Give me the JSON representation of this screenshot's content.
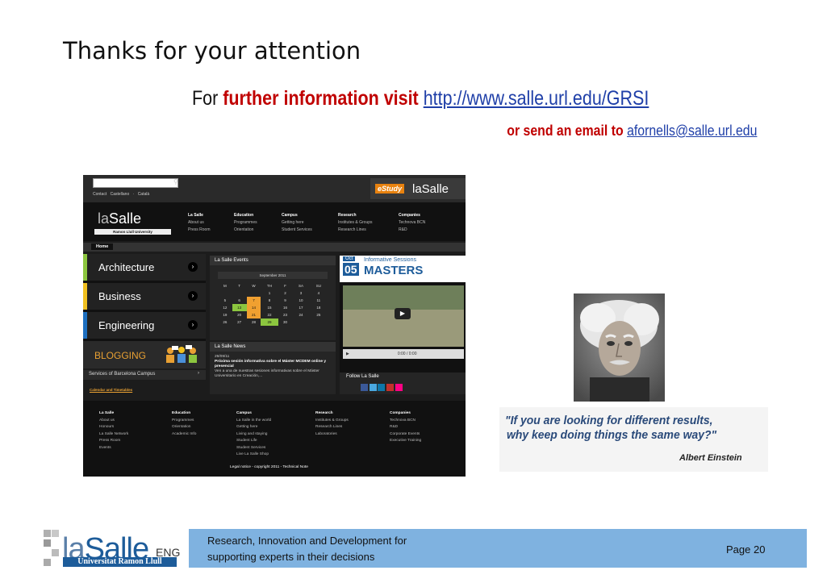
{
  "slide": {
    "title": "Thanks for your attention",
    "line1": {
      "for": "For",
      "emph": "further information visit",
      "url": "http://www.salle.url.edu/GRSI"
    },
    "line2": {
      "emph": "or send an email to",
      "email": "afornells@salle.url.edu"
    }
  },
  "website": {
    "top_links": "Contact    Castellano · Català",
    "estudy": "eStudy",
    "brand": "laSalle",
    "logo_brand_la": "la",
    "logo_brand_salle": "Salle",
    "logo_sub": "Ramon Llull University",
    "menu": [
      {
        "head": "La Salle",
        "items": [
          "About us",
          "Press Room"
        ]
      },
      {
        "head": "Education",
        "items": [
          "Programmes",
          "Orientation"
        ]
      },
      {
        "head": "Campus",
        "items": [
          "Getting here",
          "Student Services"
        ]
      },
      {
        "head": "Research",
        "items": [
          "Institutes & Groups",
          "Research Lines"
        ]
      },
      {
        "head": "Companies",
        "items": [
          "Technova BCN",
          "R&D"
        ]
      }
    ],
    "home": "Home",
    "categories": [
      "Architecture",
      "Business",
      "Engineering"
    ],
    "category_colors": [
      "#8cc63f",
      "#f0c020",
      "#1d6fc0"
    ],
    "blogging": "BLOGGING",
    "services": "Services of Barcelona Campus",
    "calendar_link": "Calendar and Timetables",
    "events_title": "La Salle Events",
    "month": "September  2011",
    "weekdays": [
      "M",
      "T",
      "W",
      "TH",
      "F",
      "SA",
      "SU"
    ],
    "calendar_rows": [
      [
        "",
        "",
        "",
        "1",
        "2",
        "3",
        "4"
      ],
      [
        "5",
        "6",
        "7",
        "8",
        "9",
        "10",
        "11"
      ],
      [
        "12",
        "13",
        "14",
        "15",
        "16",
        "17",
        "18"
      ],
      [
        "19",
        "20",
        "21",
        "22",
        "23",
        "24",
        "25"
      ],
      [
        "26",
        "27",
        "28",
        "29",
        "30",
        "",
        ""
      ]
    ],
    "video_date_month": "Oct",
    "video_date_day": "05",
    "video_label": "Informative Sessions",
    "video_title": "MASTERS",
    "video_time": "0:00 / 0:00",
    "news_title": "La Salle News",
    "news_date": "29/09/11",
    "news_headline": "Próxima sesión informativa sobre el Máster MCDEM online y presencial",
    "news_body": "Ven a una de nuestras sesiones informativas sobre el Máster Universitario en Creación,...",
    "follow": "Follow La Salle",
    "footer_cols": [
      {
        "head": "La Salle",
        "items": [
          "About us",
          "Honours",
          "La Salle Network",
          "Press Room",
          "Events"
        ]
      },
      {
        "head": "Education",
        "items": [
          "Programmes",
          "Orientation",
          "Academic Info"
        ]
      },
      {
        "head": "Campus",
        "items": [
          "La Salle in the world",
          "Getting here",
          "Living and staying",
          "Student Life",
          "Student Services",
          "Live La Salle Shop"
        ]
      },
      {
        "head": "Research",
        "items": [
          "Institutes & Groups",
          "Research Lines",
          "Laboratories"
        ]
      },
      {
        "head": "Companies",
        "items": [
          "Technova BCN",
          "R&D",
          "Corporate Events",
          "Executive Training"
        ]
      }
    ],
    "legal": "Legal notice - copyright 2011 - Technical Note"
  },
  "quote": {
    "line1": "\"If you are looking for different results,",
    "line2": "why keep doing things the same way?\"",
    "author": "Albert Einstein"
  },
  "footer": {
    "brand_la": "la",
    "brand_salle": "Salle",
    "brand_suffix": "ENG",
    "university": "Universitat Ramon Llull",
    "text1": "Research, Innovation and Development for",
    "text2": "supporting experts in their decisions",
    "page": "Page 20"
  }
}
